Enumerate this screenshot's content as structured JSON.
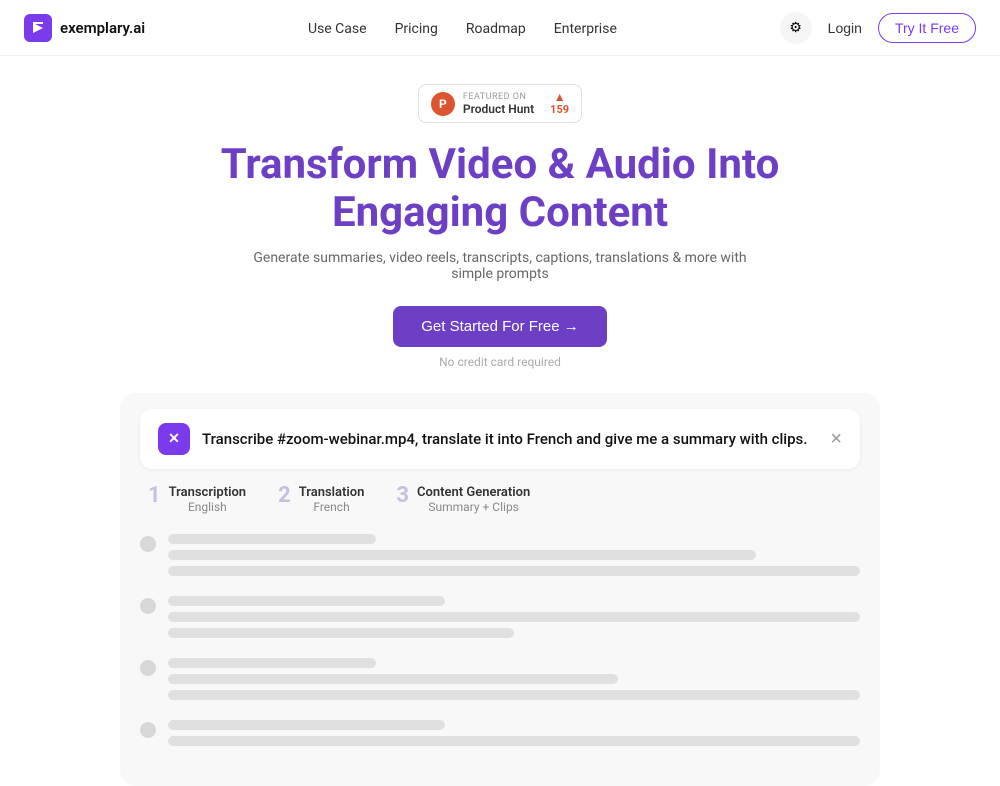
{
  "logo": {
    "text": "exemplary.ai",
    "icon_label": "x-logo-icon"
  },
  "nav": {
    "links": [
      {
        "label": "Use Case",
        "href": "#"
      },
      {
        "label": "Pricing",
        "href": "#"
      },
      {
        "label": "Roadmap",
        "href": "#"
      },
      {
        "label": "Enterprise",
        "href": "#"
      }
    ],
    "login_label": "Login",
    "try_label": "Try It Free",
    "settings_icon": "⚙"
  },
  "product_hunt": {
    "featured_text": "FEATURED ON",
    "name": "Product Hunt",
    "count": "159"
  },
  "hero": {
    "title": "Transform Video & Audio Into Engaging Content",
    "subtitle": "Generate summaries, video reels, transcripts, captions, translations & more with simple prompts",
    "cta_label": "Get Started For Free →",
    "no_card": "No credit card required"
  },
  "demo": {
    "prompt": "Transcribe #zoom-webinar.mp4, translate it into French and give me a summary with clips.",
    "close_icon": "×",
    "steps": [
      {
        "num": "1",
        "label": "Transcription",
        "value": "English"
      },
      {
        "num": "2",
        "label": "Translation",
        "value": "French"
      },
      {
        "num": "3",
        "label": "Content Generation",
        "value": "Summary + Clips"
      }
    ]
  },
  "colors": {
    "primary": "#7c3aed",
    "primary_light": "#6c3fc5",
    "text_main": "#111",
    "text_muted": "#666",
    "step_num": "#c5c0e0",
    "ph_orange": "#da552f"
  }
}
